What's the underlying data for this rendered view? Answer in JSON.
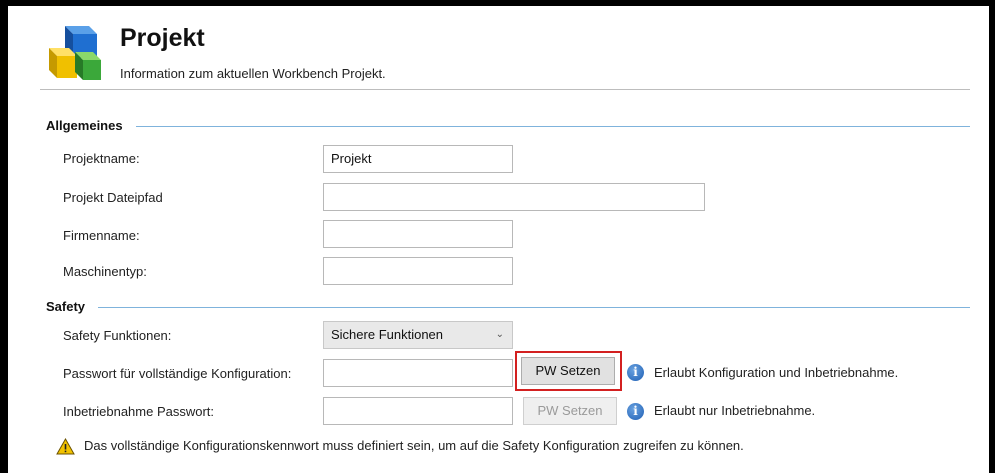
{
  "header": {
    "title": "Projekt",
    "subtitle": "Information zum aktuellen Workbench Projekt."
  },
  "sections": {
    "general": "Allgemeines",
    "safety": "Safety"
  },
  "general": {
    "project_name_label": "Projektname:",
    "project_name_value": "Projekt",
    "file_path_label": "Projekt Dateipfad",
    "file_path_value": "",
    "company_label": "Firmenname:",
    "company_value": "",
    "machine_type_label": "Maschinentyp:",
    "machine_type_value": ""
  },
  "safety": {
    "functions_label": "Safety Funktionen:",
    "functions_selected": "Sichere Funktionen",
    "full_pw_label": "Passwort für vollständige Konfiguration:",
    "full_pw_value": "",
    "full_pw_button": "PW Setzen",
    "full_pw_hint": "Erlaubt Konfiguration und Inbetriebnahme.",
    "comm_pw_label": "Inbetriebnahme Passwort:",
    "comm_pw_value": "",
    "comm_pw_button": "PW Setzen",
    "comm_pw_hint": "Erlaubt nur Inbetriebnahme.",
    "warning": "Das vollständige Konfigurationskennwort muss definiert sein, um auf die Safety Konfiguration zugreifen zu können."
  },
  "colors": {
    "section_line": "#7fb3dc",
    "highlight": "#d32020",
    "info_icon": "#1e5fb4",
    "warning_icon": "#f2c200"
  }
}
